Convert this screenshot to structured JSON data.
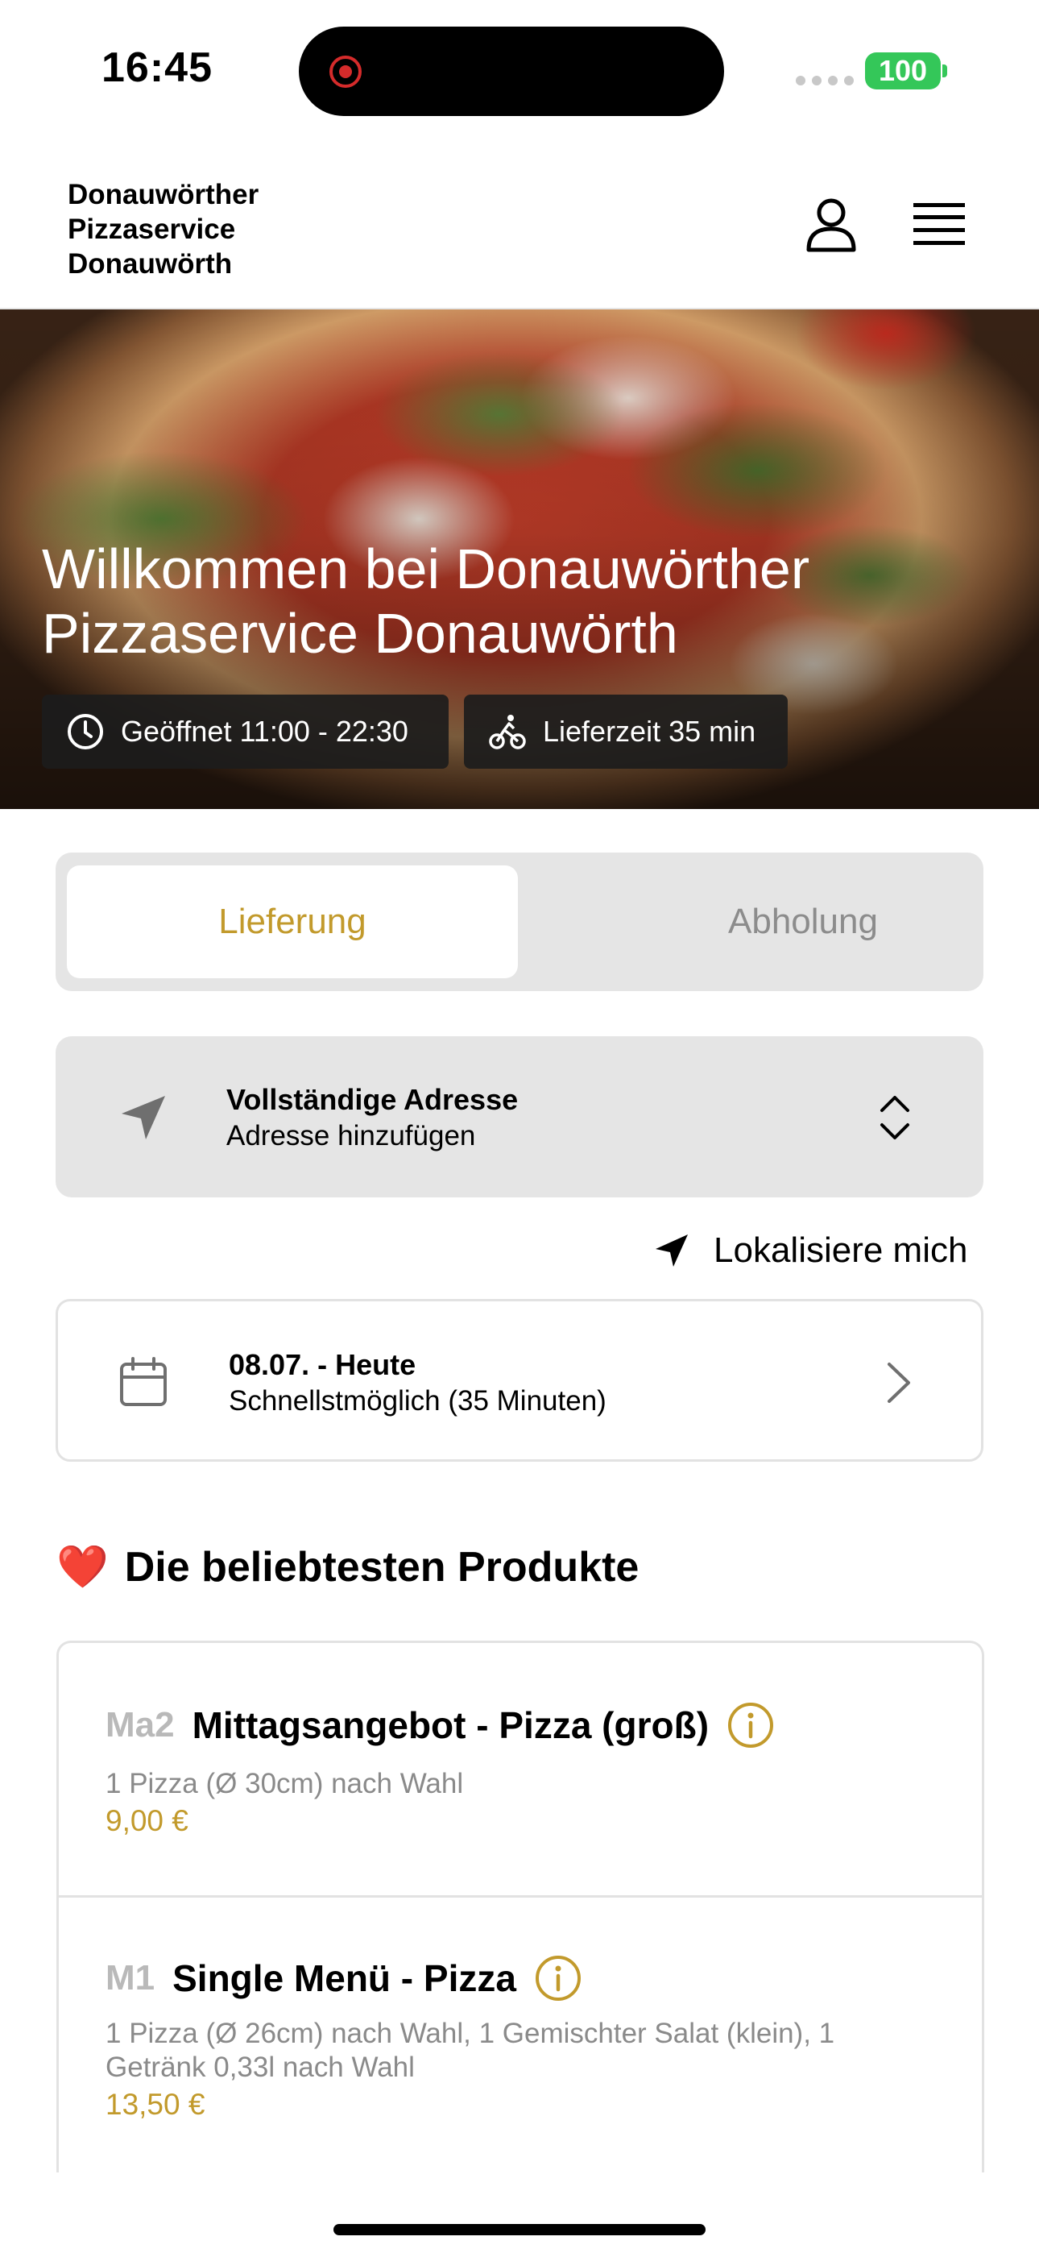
{
  "status_bar": {
    "time": "16:45",
    "battery": "100"
  },
  "header": {
    "brand": "Donauwörther\nPizzaservice\nDonauwörth"
  },
  "hero": {
    "title": "Willkommen bei Donauwörther Pizzaservice Donauwörth",
    "opening_hours": "Geöffnet 11:00 - 22:30",
    "delivery_time": "Lieferzeit 35 min"
  },
  "order_mode": {
    "delivery": "Lieferung",
    "pickup": "Abholung",
    "selected": "Lieferung"
  },
  "address": {
    "title": "Vollständige Adresse",
    "subtitle": "Adresse hinzufügen",
    "locate_label": "Lokalisiere mich"
  },
  "schedule": {
    "date": "08.07. - Heute",
    "time": "Schnellstmöglich (35 Minuten)"
  },
  "popular": {
    "heading_emoji": "❤️",
    "heading": "Die beliebtesten Produkte",
    "items": [
      {
        "code": "Ma2",
        "name": "Mittagsangebot - Pizza (groß)",
        "description": "1 Pizza (Ø 30cm) nach Wahl",
        "price": "9,00 €"
      },
      {
        "code": "M1",
        "name": "Single Menü - Pizza",
        "description": "1 Pizza (Ø 26cm) nach Wahl, 1 Gemischter Salat (klein), 1 Getränk 0,33l nach Wahl",
        "price": "13,50 €"
      }
    ]
  },
  "colors": {
    "accent": "#c29a2c",
    "card_gray": "#e5e5e5",
    "battery": "#34c759"
  },
  "icons": [
    "user-icon",
    "menu-icon",
    "clock-icon",
    "bicycle-icon",
    "location-arrow-icon",
    "chevron-up-down-icon",
    "calendar-icon",
    "chevron-right-icon",
    "info-icon",
    "heart-icon"
  ]
}
